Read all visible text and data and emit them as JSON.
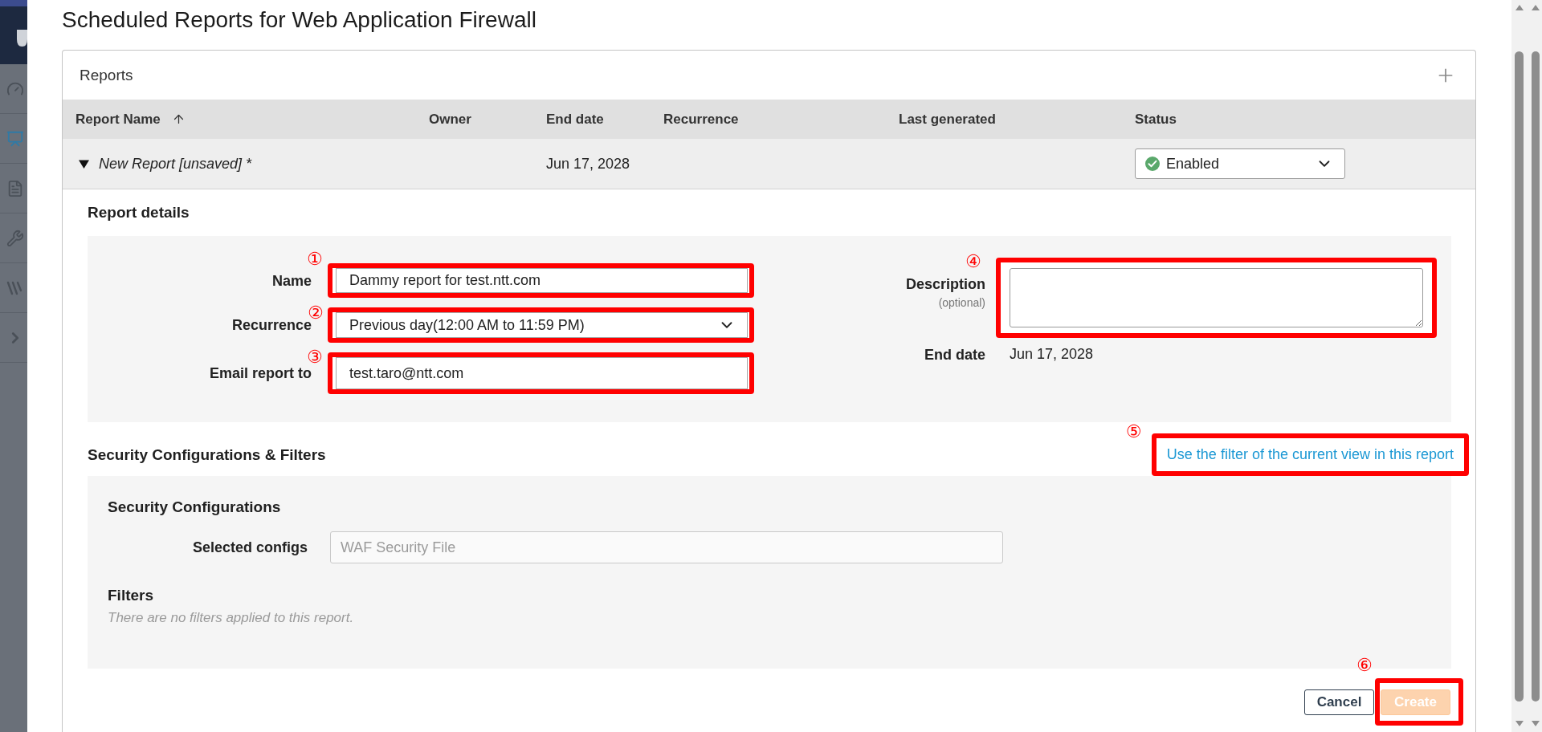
{
  "dialog": {
    "title": "Scheduled Reports for Web Application Firewall"
  },
  "reports_panel": {
    "title": "Reports"
  },
  "table": {
    "columns": [
      {
        "label": "Report Name",
        "sorted": true
      },
      {
        "label": "Owner",
        "sorted": false
      },
      {
        "label": "End date",
        "sorted": false
      },
      {
        "label": "Recurrence",
        "sorted": false
      },
      {
        "label": "Last generated",
        "sorted": false
      },
      {
        "label": "Status",
        "sorted": false
      }
    ],
    "rows": [
      {
        "name": "New Report [unsaved] *",
        "expanded": true,
        "end_date": "Jun 17, 2028",
        "status": {
          "value": "Enabled",
          "enabled": true
        }
      }
    ]
  },
  "report_details": {
    "heading": "Report details",
    "fields": [
      {
        "kind": "text",
        "label": "Name",
        "value": "Dammy report for test.ntt.com",
        "marker": "①"
      },
      {
        "kind": "select",
        "label": "Recurrence",
        "value": "Previous day(12:00 AM to 11:59 PM)",
        "marker": "②"
      },
      {
        "kind": "email",
        "label": "Email report to",
        "value": "test.taro@ntt.com",
        "marker": "③"
      }
    ],
    "description": {
      "label": "Description",
      "hint": "(optional)",
      "marker": "④"
    },
    "end_date": {
      "label": "End date",
      "value": "Jun 17, 2028"
    }
  },
  "security_section": {
    "heading": "Security Configurations & Filters",
    "filter_link": {
      "label": "Use the filter of the current view in this report",
      "marker": "⑤"
    },
    "configurations": {
      "heading": "Security Configurations",
      "label": "Selected configs",
      "value": "WAF Security File",
      "disabled": true
    },
    "filters": {
      "heading": "Filters",
      "empty_text": "There are no filters applied to this report."
    }
  },
  "buttons": [
    {
      "kind": "secondary",
      "label": "Cancel",
      "disabled": false
    },
    {
      "kind": "primary",
      "label": "Create",
      "disabled": true,
      "marker": "⑥"
    }
  ]
}
